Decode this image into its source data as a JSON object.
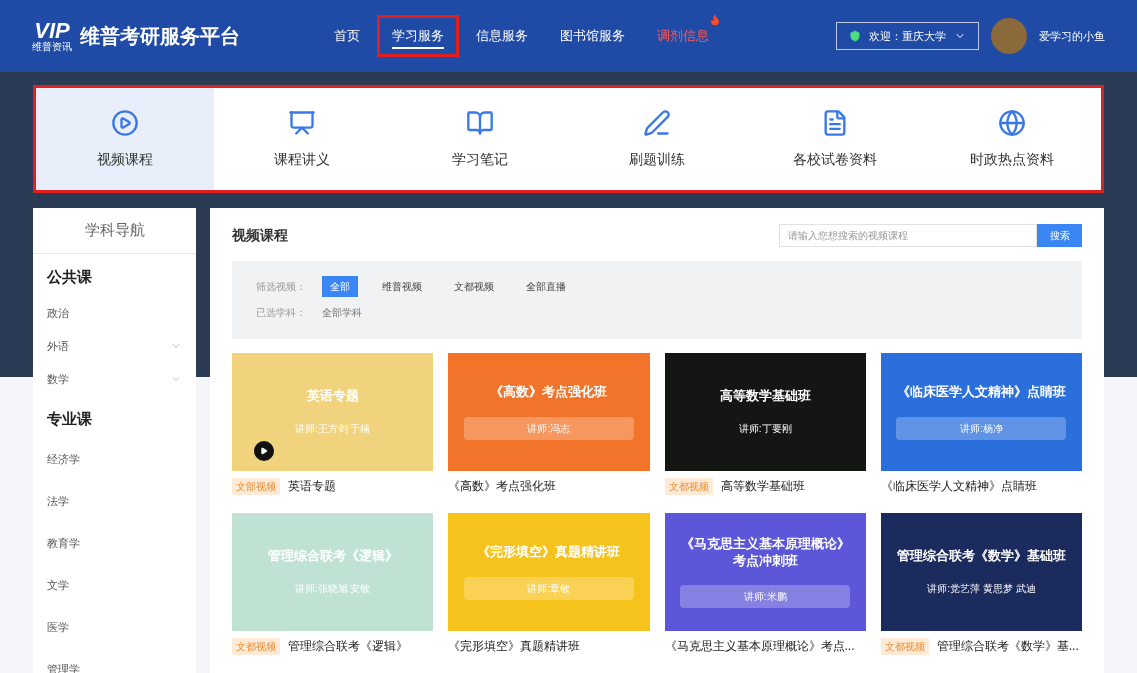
{
  "header": {
    "logo": {
      "mark": "VIP",
      "sub": "维普资讯"
    },
    "title": "维普考研服务平台",
    "nav": [
      {
        "label": "首页",
        "selected": false,
        "highlighted": false,
        "hot": false
      },
      {
        "label": "学习服务",
        "selected": true,
        "highlighted": true,
        "hot": false
      },
      {
        "label": "信息服务",
        "selected": false,
        "highlighted": false,
        "hot": false
      },
      {
        "label": "图书馆服务",
        "selected": false,
        "highlighted": false,
        "hot": false
      },
      {
        "label": "调剂信息",
        "selected": false,
        "highlighted": false,
        "hot": true
      }
    ],
    "welcome": "欢迎：重庆大学",
    "username": "爱学习的小鱼"
  },
  "categories": {
    "highlighted": true,
    "items": [
      {
        "kind": "video",
        "label": "视频课程",
        "selected": true
      },
      {
        "kind": "slides",
        "label": "课程讲义",
        "selected": false
      },
      {
        "kind": "notes",
        "label": "学习笔记",
        "selected": false
      },
      {
        "kind": "practice",
        "label": "刷题训练",
        "selected": false
      },
      {
        "kind": "papers",
        "label": "各校试卷资料",
        "selected": false
      },
      {
        "kind": "news",
        "label": "时政热点资料",
        "selected": false
      }
    ]
  },
  "sidebar": {
    "title": "学科导航",
    "groups": [
      {
        "title": "公共课",
        "items": [
          {
            "label": "政治",
            "expandable": false
          },
          {
            "label": "外语",
            "expandable": true
          },
          {
            "label": "数学",
            "expandable": true
          }
        ]
      },
      {
        "title": "专业课",
        "items": [
          {
            "label": "经济学",
            "expandable": false
          },
          {
            "label": "法学",
            "expandable": false
          },
          {
            "label": "教育学",
            "expandable": false
          },
          {
            "label": "文学",
            "expandable": false
          },
          {
            "label": "医学",
            "expandable": false
          },
          {
            "label": "管理学",
            "expandable": false
          }
        ]
      }
    ]
  },
  "main": {
    "title": "视频课程",
    "search": {
      "placeholder": "请输入您想搜索的视频课程",
      "button": "搜索"
    },
    "filter": {
      "label": "筛选视频：",
      "options": [
        {
          "label": "全部",
          "selected": true
        },
        {
          "label": "维普视频",
          "selected": false
        },
        {
          "label": "文都视频",
          "selected": false
        },
        {
          "label": "全部直播",
          "selected": false
        }
      ],
      "subject_label": "已选学科：",
      "subject": "全部学科"
    },
    "courses": [
      {
        "thumb_title": "英语专题",
        "lecturer": "讲师:王方剑 于楠",
        "lecturer_bar": false,
        "play": true,
        "color": "#f0d37c",
        "badge": "文部视频",
        "title": "英语专题"
      },
      {
        "thumb_title": "《高数》考点强化班",
        "lecturer": "讲师:冯志",
        "lecturer_bar": true,
        "play": false,
        "color": "#f2742a",
        "title": "《高数》考点强化班"
      },
      {
        "thumb_title": "高等数学基础班",
        "lecturer": "讲师:丁要刚",
        "lecturer_bar": false,
        "play": false,
        "color": "#141614",
        "badge": "文都视频",
        "title": "高等数学基础班"
      },
      {
        "thumb_title": "《临床医学人文精神》点睛班",
        "lecturer": "讲师:杨净",
        "lecturer_bar": true,
        "play": false,
        "color": "#2b6fdc",
        "title": "《临床医学人文精神》点睛班"
      },
      {
        "thumb_title": "管理综合联考《逻辑》",
        "lecturer": "讲师:张晓旭 安敏",
        "lecturer_bar": false,
        "play": false,
        "color": "#bfe2d2",
        "badge": "文都视频",
        "title": "管理综合联考《逻辑》"
      },
      {
        "thumb_title": "《完形填空》真题精讲班",
        "lecturer": "讲师:章敏",
        "lecturer_bar": true,
        "play": false,
        "color": "#f6c21c",
        "title": "《完形填空》真题精讲班"
      },
      {
        "thumb_title": "《马克思主义基本原理概论》",
        "thumb_title_2": "考点冲刺班",
        "lecturer": "讲师:米鹏",
        "lecturer_bar": true,
        "play": false,
        "color": "#5c57d8",
        "title": "《马克思主义基本原理概论》考点..."
      },
      {
        "thumb_title": "管理综合联考《数学》基础班",
        "lecturer": "讲师:党艺萍 黄思梦 武迪",
        "lecturer_bar": false,
        "play": false,
        "color": "#1c2b5e",
        "badge": "文都视频",
        "title": "管理综合联考《数学》基..."
      }
    ]
  }
}
